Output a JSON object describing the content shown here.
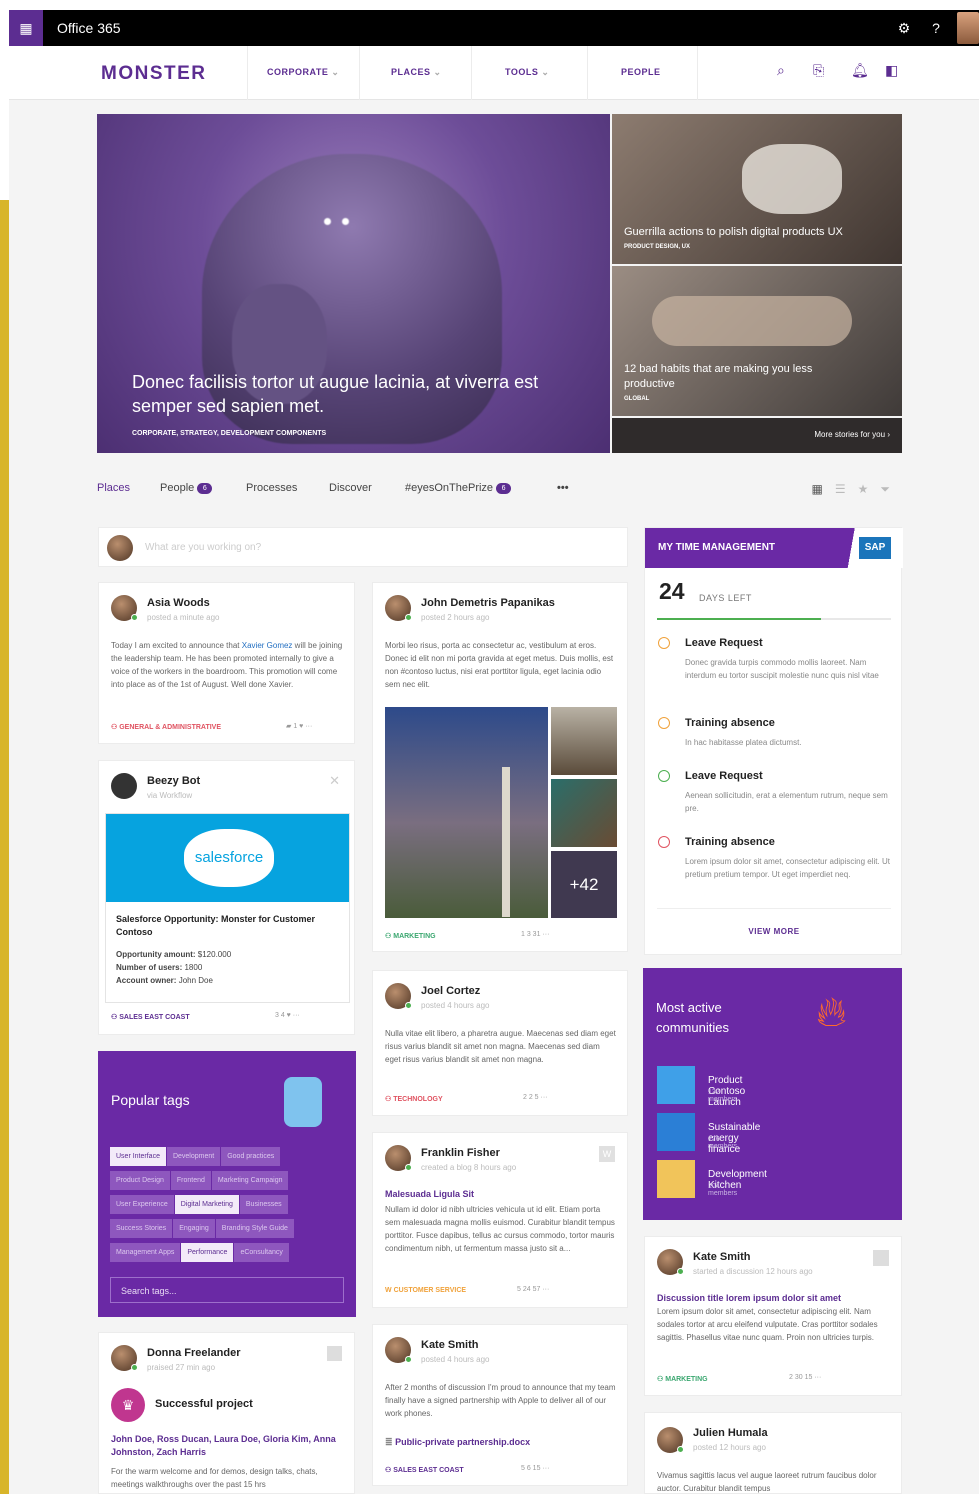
{
  "topbar": {
    "app_title": "Office 365",
    "settings_icon": "gear-icon",
    "help_label": "?"
  },
  "nav": {
    "logo": "MONSTER",
    "items": [
      "CORPORATE",
      "PLACES",
      "TOOLS",
      "PEOPLE"
    ],
    "caret": "⌄"
  },
  "hero": {
    "main": {
      "title": "Donec facilisis tortor ut augue lacinia, at viverra est semper sed sapien met.",
      "tag": "CORPORATE, STRATEGY, DEVELOPMENT COMPONENTS"
    },
    "stories": [
      {
        "title": "Guerrilla actions to polish digital products UX",
        "tag": "PRODUCT DESIGN, UX"
      },
      {
        "title": "12 bad habits that are making you less productive",
        "tag": "GLOBAL"
      }
    ],
    "more": "More stories for you"
  },
  "tabs": {
    "places": "Places",
    "people": "People",
    "people_count": "6",
    "processes": "Processes",
    "discover": "Discover",
    "eyes": "#eyesOnThePrize",
    "eyes_count": "6",
    "more": "•••"
  },
  "composer": {
    "placeholder": "What are you working on?"
  },
  "posts": {
    "asia": {
      "name": "Asia Woods",
      "meta": "posted a minute ago",
      "text_1": "Today I am excited to announce that ",
      "mention": "Xavier Gomez",
      "text_2": " will be joining the leadership team. He has been promoted internally to give a voice of the workers in the boardroom. This promotion will come into place as of the 1st of August. Well done Xavier.",
      "tag": "GENERAL & ADMINISTRATIVE",
      "stats": "1"
    },
    "beezy": {
      "name": "Beezy Bot",
      "meta": "via Workflow",
      "brand": "salesforce",
      "title": "Salesforce Opportunity: Monster for Customer Contoso",
      "amount_label": "Opportunity amount:",
      "amount": "$120.000",
      "users_label": "Number of users:",
      "users": "1800",
      "owner_label": "Account owner:",
      "owner": "John Doe",
      "tag": "SALES EAST COAST",
      "stats": "3  4"
    },
    "john": {
      "name": "John Demetris Papanikas",
      "meta": "posted 2 hours ago",
      "text": "Morbi leo risus, porta ac consectetur ac, vestibulum at eros. Donec id elit non mi porta gravida at eget metus. Duis mollis, est non #contoso luctus, nisi erat porttitor ligula, eget lacinia odio sem nec elit.",
      "more_photos": "+42",
      "tag": "MARKETING",
      "stats": "1   3   31"
    },
    "joel": {
      "name": "Joel Cortez",
      "meta": "posted 4 hours ago",
      "text": "Nulla vitae elit libero, a pharetra augue. Maecenas sed diam eget risus varius blandit sit amet non magna. Maecenas sed diam eget risus varius blandit sit amet non magna.",
      "tag": "TECHNOLOGY",
      "stats": "2   2   5"
    },
    "franklin": {
      "name": "Franklin Fisher",
      "meta": "created a blog 8 hours ago",
      "blog_title": "Malesuada Ligula Sit",
      "text": "Nullam id dolor id nibh ultricies vehicula ut id elit. Etiam porta sem malesuada magna mollis euismod. Curabitur blandit tempus porttitor. Fusce dapibus, tellus ac cursus commodo, tortor mauris condimentum nibh, ut fermentum massa justo sit a...",
      "tag": "CUSTOMER SERVICE",
      "stats": "5   24   57"
    },
    "kate2": {
      "name": "Kate Smith",
      "meta": "posted 4 hours ago",
      "text": "After 2 months of discussion I'm proud to announce that my team finally have a signed partnership with Apple to deliver all of our work phones.",
      "file": "Public-private partnership.docx",
      "tag": "SALES EAST COAST",
      "stats": "5   6   15"
    },
    "donna": {
      "name": "Donna Freelander",
      "meta": "praised 27 min ago",
      "praise": "Successful project",
      "people": "John Doe, Ross Ducan, Laura Doe, Gloria Kim, Anna Johnston, Zach Harris",
      "text": "For the warm welcome and for demos, design talks, chats, meetings walkthroughs over the past 15 hrs"
    },
    "kate1": {
      "name": "Kate Smith",
      "meta": "started a discussion 12 hours ago",
      "title": "Discussion title lorem ipsum dolor sit amet",
      "text": "Lorem ipsum dolor sit amet, consectetur adipiscing elit. Nam sodales tortor at arcu eleifend vulputate. Cras porttitor sodales sagittis. Phasellus vitae nunc quam. Proin non ultricies turpis.",
      "tag": "MARKETING",
      "stats": "2   30   15"
    },
    "julien": {
      "name": "Julien Humala",
      "meta": "posted 12 hours ago",
      "text": "Vivamus sagittis lacus vel augue laoreet rutrum faucibus dolor auctor. Curabitur blandit tempus"
    }
  },
  "tags": {
    "title": "Popular tags",
    "rows": [
      [
        {
          "t": "User Interface",
          "on": true
        },
        {
          "t": "Development",
          "on": false
        },
        {
          "t": "Good practices",
          "on": false
        }
      ],
      [
        {
          "t": "Product Design",
          "on": false
        },
        {
          "t": "Frontend",
          "on": false
        },
        {
          "t": "Marketing Campaign",
          "on": false
        }
      ],
      [
        {
          "t": "User Experience",
          "on": false
        },
        {
          "t": "Digital Marketing",
          "on": true
        },
        {
          "t": "Businesses",
          "on": false
        }
      ],
      [
        {
          "t": "Success Stories",
          "on": false
        },
        {
          "t": "Engaging",
          "on": false
        },
        {
          "t": "Branding Style Guide",
          "on": false
        }
      ],
      [
        {
          "t": "Management Apps",
          "on": false
        },
        {
          "t": "Performance",
          "on": true
        },
        {
          "t": "eConsultancy",
          "on": false
        }
      ]
    ],
    "search_placeholder": "Search tags..."
  },
  "time": {
    "title": "MY TIME MANAGEMENT",
    "brand": "SAP",
    "days": "24",
    "days_label": "DAYS LEFT",
    "progress": 0.7,
    "items": [
      {
        "title": "Leave Request",
        "desc": "Donec gravida turpis commodo mollis laoreet. Nam interdum eu tortor suscipit molestie nunc quis nisl vitae",
        "icon": "clock-icon",
        "color": "#f0a23b"
      },
      {
        "title": "Training absence",
        "desc": "In hac habitasse platea dictumst.",
        "icon": "clock-icon",
        "color": "#f0a23b"
      },
      {
        "title": "Leave Request",
        "desc": "Aenean sollicitudin, erat a elementum rutrum, neque sem pre.",
        "icon": "check-icon",
        "color": "#4caf50"
      },
      {
        "title": "Training absence",
        "desc": "Lorem ipsum dolor sit amet, consectetur adipiscing elit. Ut pretium pretium tempor. Ut eget imperdiet neq.",
        "icon": "x-circle-icon",
        "color": "#e05361"
      }
    ],
    "view_more": "VIEW MORE"
  },
  "communities": {
    "title": "Most active communities",
    "items": [
      {
        "name": "Product Contoso Launch",
        "members": "132 members",
        "color": "#3fa0e8"
      },
      {
        "name": "Sustainable energy finance",
        "members": "176 members",
        "color": "#2b7fd6"
      },
      {
        "name": "Development Kitchen",
        "members": "104 members",
        "color": "#f1c45a"
      }
    ]
  }
}
